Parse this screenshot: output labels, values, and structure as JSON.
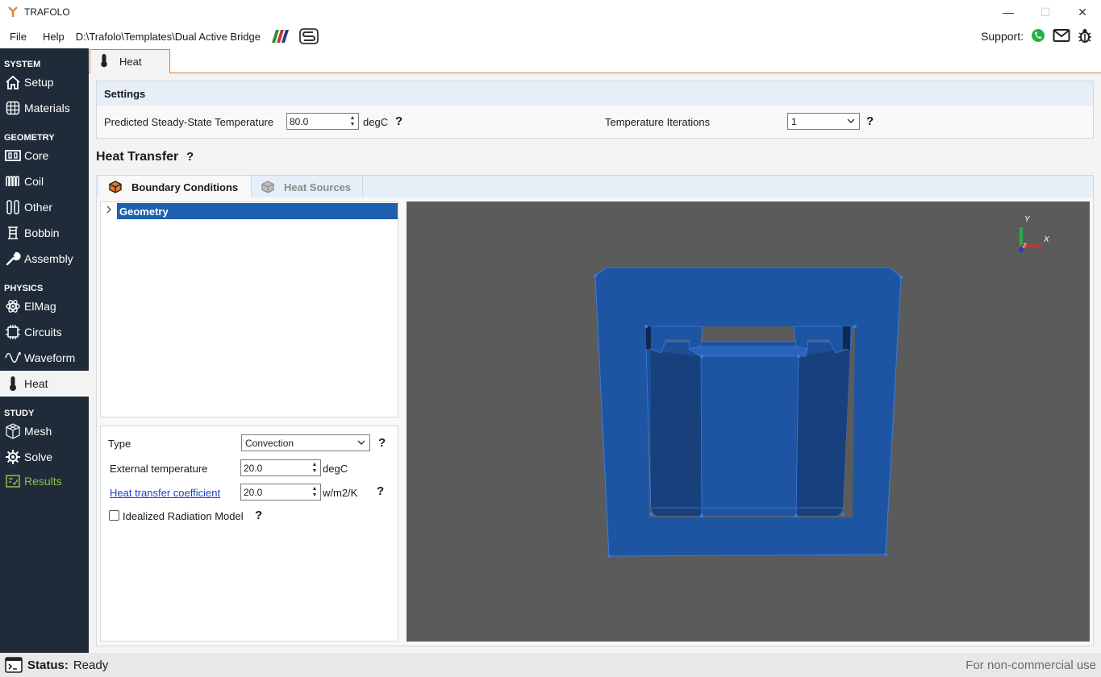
{
  "window": {
    "title": "TRAFOLO",
    "minimize": "—",
    "maximize": "☐",
    "close": "✕"
  },
  "menu": {
    "file": "File",
    "help": "Help",
    "path": "D:\\Trafolo\\Templates\\Dual Active Bridge"
  },
  "support": {
    "label": "Support:"
  },
  "sidebar": {
    "system": "SYSTEM",
    "setup": "Setup",
    "materials": "Materials",
    "geometry": "GEOMETRY",
    "core": "Core",
    "coil": "Coil",
    "other": "Other",
    "bobbin": "Bobbin",
    "assembly": "Assembly",
    "physics": "PHYSICS",
    "elmag": "ElMag",
    "circuits": "Circuits",
    "waveform": "Waveform",
    "heat": "Heat",
    "study": "STUDY",
    "mesh": "Mesh",
    "solve": "Solve",
    "results": "Results"
  },
  "tab": {
    "heat": "Heat"
  },
  "settings": {
    "header": "Settings",
    "predicted_label": "Predicted Steady-State Temperature",
    "predicted_value": "80.0",
    "predicted_unit": "degC",
    "iterations_label": "Temperature Iterations",
    "iterations_value": "1"
  },
  "heat_transfer": {
    "title": "Heat Transfer",
    "tabs": {
      "boundary": "Boundary Conditions",
      "sources": "Heat Sources"
    },
    "tree": {
      "root": "Geometry"
    },
    "props": {
      "type_label": "Type",
      "type_value": "Convection",
      "ext_temp_label": "External temperature",
      "ext_temp_value": "20.0",
      "ext_temp_unit": "degC",
      "htc_label": "Heat transfer coefficient",
      "htc_value": "20.0",
      "htc_unit": "w/m2/K",
      "radiation_label": "Idealized Radiation Model"
    }
  },
  "help_mark": "?",
  "axes": {
    "x": "X",
    "y": "Y",
    "z": "Z"
  },
  "status": {
    "label": "Status:",
    "value": "Ready",
    "license": "For non-commercial use"
  },
  "colors": {
    "sidebar_bg": "#1f2b38",
    "accent": "#e07a2c",
    "selection": "#1f5fb0",
    "model_blue": "#1d55a3",
    "results_green": "#8bc34a"
  }
}
